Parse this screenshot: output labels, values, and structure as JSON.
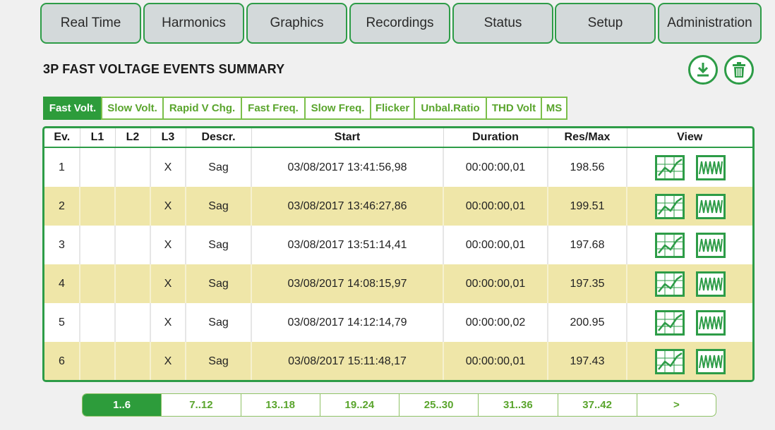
{
  "nav": {
    "tabs": [
      "Real Time",
      "Harmonics",
      "Graphics",
      "Recordings",
      "Status",
      "Setup",
      "Administration"
    ]
  },
  "page": {
    "title": "3P FAST VOLTAGE EVENTS SUMMARY",
    "download_icon": "download-icon",
    "delete_icon": "trash-icon"
  },
  "subtabs": {
    "items": [
      "Fast Volt.",
      "Slow Volt.",
      "Rapid V Chg.",
      "Fast Freq.",
      "Slow Freq.",
      "Flicker",
      "Unbal.Ratio",
      "THD Volt",
      "MS"
    ],
    "active_index": 0
  },
  "table": {
    "headers": [
      "Ev.",
      "L1",
      "L2",
      "L3",
      "Descr.",
      "Start",
      "Duration",
      "Res/Max",
      "View"
    ],
    "rows": [
      {
        "ev": "1",
        "l1": "",
        "l2": "",
        "l3": "X",
        "descr": "Sag",
        "start": "03/08/2017 13:41:56,98",
        "duration": "00:00:00,01",
        "resmax": "198.56"
      },
      {
        "ev": "2",
        "l1": "",
        "l2": "",
        "l3": "X",
        "descr": "Sag",
        "start": "03/08/2017 13:46:27,86",
        "duration": "00:00:00,01",
        "resmax": "199.51"
      },
      {
        "ev": "3",
        "l1": "",
        "l2": "",
        "l3": "X",
        "descr": "Sag",
        "start": "03/08/2017 13:51:14,41",
        "duration": "00:00:00,01",
        "resmax": "197.68"
      },
      {
        "ev": "4",
        "l1": "",
        "l2": "",
        "l3": "X",
        "descr": "Sag",
        "start": "03/08/2017 14:08:15,97",
        "duration": "00:00:00,01",
        "resmax": "197.35"
      },
      {
        "ev": "5",
        "l1": "",
        "l2": "",
        "l3": "X",
        "descr": "Sag",
        "start": "03/08/2017 14:12:14,79",
        "duration": "00:00:00,02",
        "resmax": "200.95"
      },
      {
        "ev": "6",
        "l1": "",
        "l2": "",
        "l3": "X",
        "descr": "Sag",
        "start": "03/08/2017 15:11:48,17",
        "duration": "00:00:00,01",
        "resmax": "197.43"
      }
    ],
    "view_icons": [
      "trend-chart-icon",
      "waveform-icon"
    ]
  },
  "pagination": {
    "pages": [
      "1..6",
      "7..12",
      "13..18",
      "19..24",
      "25..30",
      "31..36",
      "37..42",
      ">"
    ],
    "active_index": 0
  },
  "colors": {
    "accent": "#2d9c47",
    "tab_bg": "#d3d9da",
    "alt_row": "#efe6a8",
    "subtab_text": "#5aa52d"
  }
}
